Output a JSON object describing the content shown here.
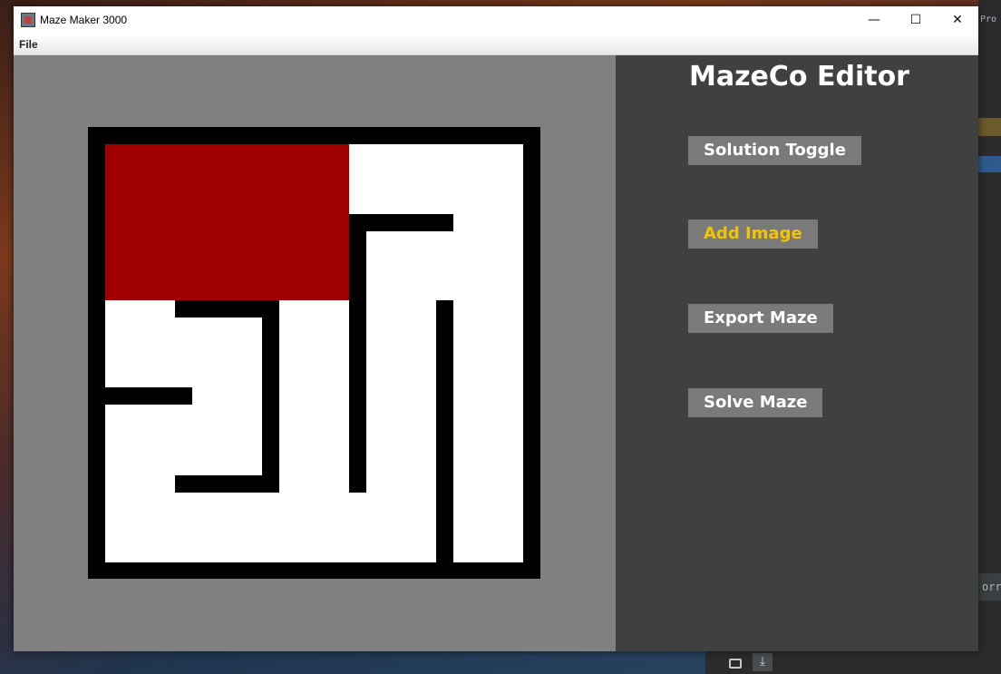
{
  "window": {
    "title": "Maze Maker 3000",
    "controls": {
      "minimize": "—",
      "maximize": "☐",
      "close": "✕"
    }
  },
  "menubar": {
    "file": "File"
  },
  "panel": {
    "title": "MazeCo Editor",
    "buttons": {
      "solution_toggle": "Solution Toggle",
      "add_image": "Add Image",
      "export_maze": "Export Maze",
      "solve_maze": "Solve Maze"
    }
  },
  "colors": {
    "canvas_bg": "#808080",
    "panel_bg": "#404040",
    "maze_wall": "#000000",
    "maze_path": "#ffffff",
    "image_cell": "#a00000",
    "button_bg": "#7a7a7a",
    "button_highlight_text": "#f5c400"
  },
  "icons": {
    "app": "maze-app-icon"
  },
  "desktop": {
    "ide_snippet": "orre",
    "ide_top": "Pro"
  }
}
